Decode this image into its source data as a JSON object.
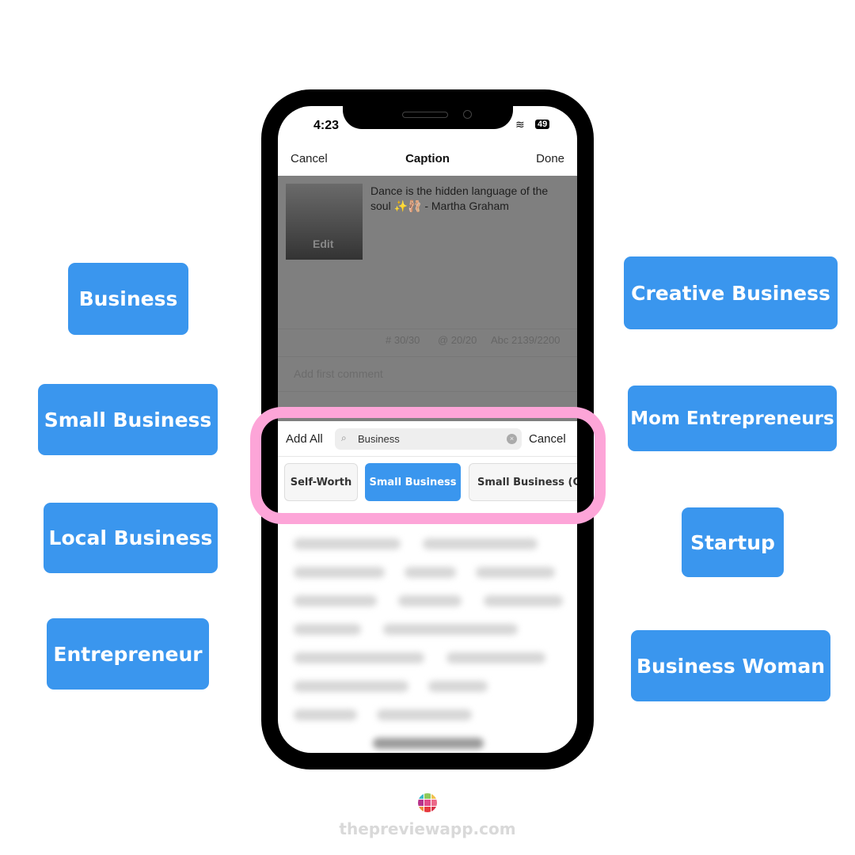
{
  "left_labels": [
    "Business",
    "Small Business",
    "Local Business",
    "Entrepreneur"
  ],
  "right_labels": [
    "Creative Business",
    "Mom Entrepreneurs",
    "Startup",
    "Business Woman"
  ],
  "status": {
    "time": "4:23",
    "battery": "49"
  },
  "header": {
    "cancel": "Cancel",
    "title": "Caption",
    "done": "Done"
  },
  "post": {
    "caption": "Dance is the hidden language of the soul ✨🩰 - Martha Graham",
    "edit": "Edit"
  },
  "counts": {
    "hashtags": "# 30/30",
    "mentions": "@ 20/20",
    "chars": "Abc 2139/2200"
  },
  "comment_placeholder": "Add first comment",
  "search": {
    "add_all": "Add All",
    "value": "Business",
    "cancel": "Cancel"
  },
  "chips": [
    {
      "label": "Self-Worth",
      "selected": false
    },
    {
      "label": "Small Business",
      "selected": true
    },
    {
      "label": "Small Business (Co",
      "selected": false
    }
  ],
  "footer": {
    "site": "thepreviewapp.com"
  },
  "colors": {
    "accent": "#3a96ee",
    "highlight": "#fda5d8"
  }
}
